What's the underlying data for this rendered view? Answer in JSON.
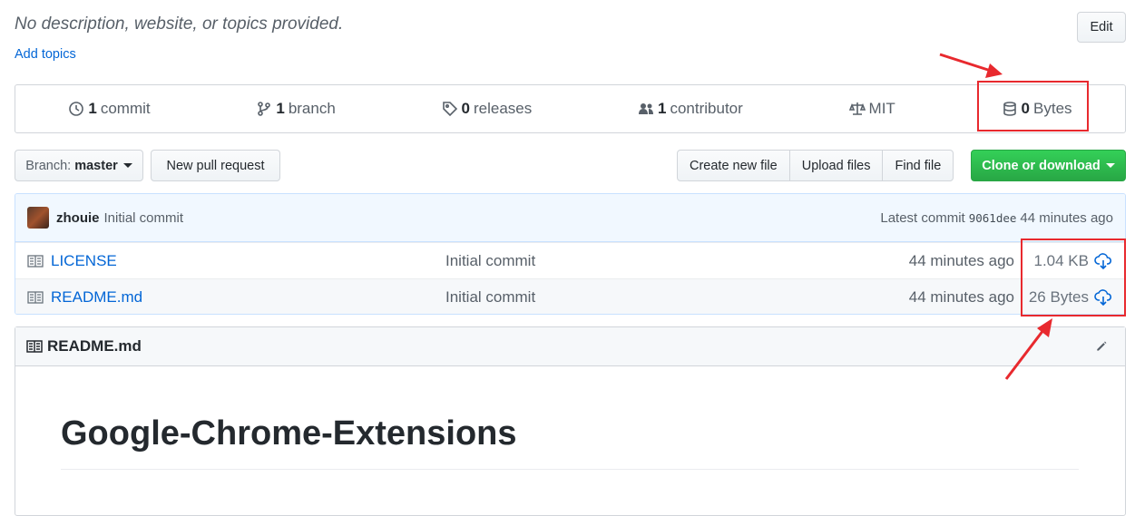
{
  "repo": {
    "description": "No description, website, or topics provided.",
    "add_topics": "Add topics",
    "edit_label": "Edit"
  },
  "summary": {
    "commits": {
      "num": "1",
      "label": "commit",
      "icon": "history-icon"
    },
    "branches": {
      "num": "1",
      "label": "branch",
      "icon": "branch-icon"
    },
    "releases": {
      "num": "0",
      "label": "releases",
      "icon": "tag-icon"
    },
    "contributors": {
      "num": "1",
      "label": "contributor",
      "icon": "people-icon"
    },
    "license": {
      "label": "MIT",
      "icon": "law-icon"
    },
    "size": {
      "num": "0",
      "label": "Bytes",
      "icon": "database-icon"
    }
  },
  "toolbar": {
    "branch_prefix": "Branch:",
    "branch_name": "master",
    "new_pr": "New pull request",
    "create_file": "Create new file",
    "upload_files": "Upload files",
    "find_file": "Find file",
    "clone": "Clone or download"
  },
  "latest_commit": {
    "author": "zhouie",
    "message": "Initial commit",
    "prefix": "Latest commit",
    "sha": "9061dee",
    "age": "44 minutes ago"
  },
  "files": [
    {
      "name": "LICENSE",
      "message": "Initial commit",
      "age": "44 minutes ago",
      "size": "1.04 KB"
    },
    {
      "name": "README.md",
      "message": "Initial commit",
      "age": "44 minutes ago",
      "size": "26 Bytes"
    }
  ],
  "readme": {
    "header": "README.md",
    "title": "Google-Chrome-Extensions"
  },
  "colors": {
    "accent": "#0366d6",
    "clone_green": "#28a745",
    "annotation_red": "#e8292e"
  }
}
